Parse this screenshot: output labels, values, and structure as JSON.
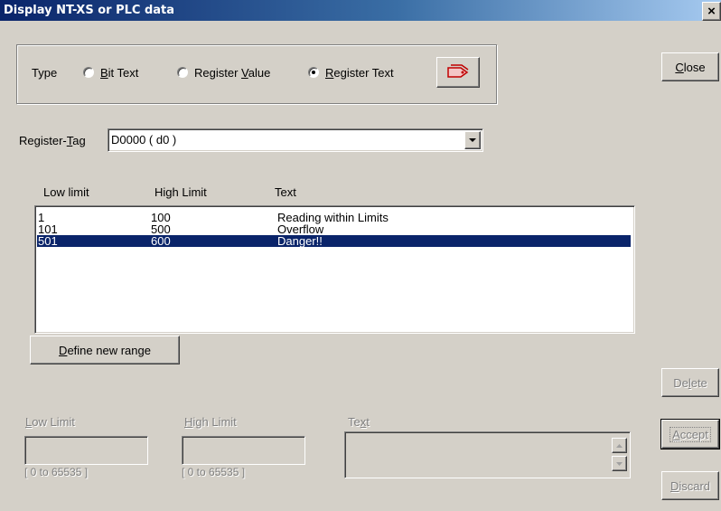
{
  "window": {
    "title": "Display NT-XS or PLC data",
    "close_glyph": "×"
  },
  "type_group": {
    "label": "Type",
    "options": [
      {
        "pre": "",
        "mnemonic": "B",
        "post": "it Text",
        "selected": false
      },
      {
        "pre": "Register ",
        "mnemonic": "V",
        "post": "alue",
        "selected": false
      },
      {
        "pre": "",
        "mnemonic": "R",
        "post": "egister Text",
        "selected": true
      }
    ],
    "action_icon": "tags-icon"
  },
  "register_tag": {
    "label_pre": "Register-",
    "label_mnemonic": "T",
    "label_post": "ag",
    "value": "D0000 ( d0 )"
  },
  "table": {
    "columns": [
      "Low limit",
      "High Limit",
      "Text"
    ],
    "rows": [
      {
        "low": "1",
        "high": "100",
        "text": "Reading within Limits",
        "selected": false
      },
      {
        "low": "101",
        "high": "500",
        "text": "Overflow",
        "selected": false
      },
      {
        "low": "501",
        "high": "600",
        "text": "Danger!!",
        "selected": true
      }
    ]
  },
  "define_button": {
    "mnemonic": "D",
    "post": "efine new range"
  },
  "edit": {
    "low_label": {
      "mnemonic": "L",
      "post": "ow Limit"
    },
    "high_label": {
      "mnemonic": "H",
      "post": "igh Limit"
    },
    "text_label": {
      "pre": "Te",
      "mnemonic": "x",
      "post": "t"
    },
    "low_range": "[ 0 to 65535 ]",
    "high_range": "[ 0 to 65535 ]",
    "low_value": "",
    "high_value": "",
    "text_value": ""
  },
  "buttons": {
    "close": {
      "mnemonic": "C",
      "post": "lose"
    },
    "delete": {
      "pre": "De",
      "mnemonic": "l",
      "post": "ete"
    },
    "accept": {
      "mnemonic": "A",
      "post": "ccept"
    },
    "discard": {
      "mnemonic": "D",
      "post": "iscard"
    }
  }
}
